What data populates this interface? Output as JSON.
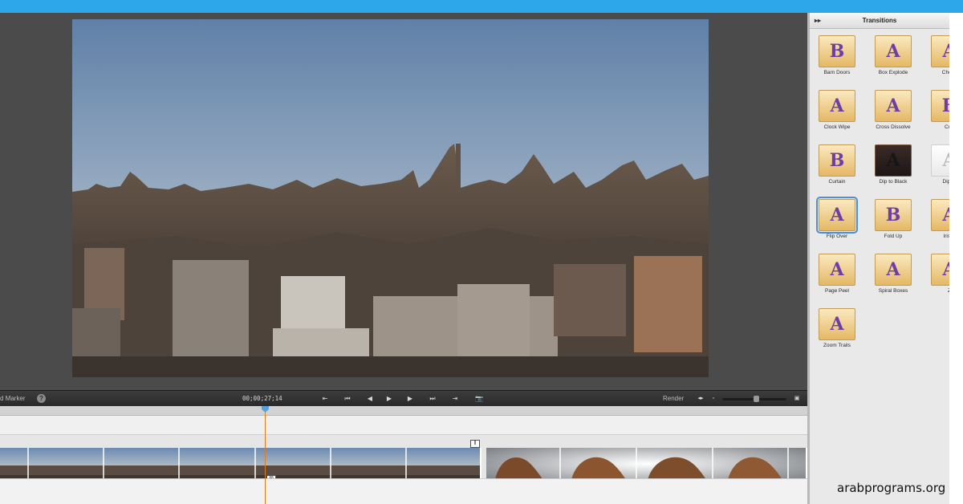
{
  "monitor": {
    "timecode": "00;00;27;14",
    "marker_label": "d Marker",
    "help_label": "?",
    "render_label": "Render",
    "controls": [
      {
        "name": "go-to-start-button",
        "glyph": "⇤"
      },
      {
        "name": "previous-edit-button",
        "glyph": "⏮"
      },
      {
        "name": "step-back-button",
        "glyph": "◀"
      },
      {
        "name": "play-button",
        "glyph": "▶"
      },
      {
        "name": "step-forward-button",
        "glyph": "▶"
      },
      {
        "name": "next-edit-button",
        "glyph": "⏭"
      },
      {
        "name": "go-to-end-button",
        "glyph": "⇥"
      },
      {
        "name": "snapshot-button",
        "glyph": "📷"
      }
    ]
  },
  "transitions": {
    "title": "Transitions",
    "collapse_glyph": "▸▸",
    "items": [
      {
        "label": "Barn Doors",
        "glyph": "B",
        "style": ""
      },
      {
        "label": "Box Explode",
        "glyph": "A",
        "style": ""
      },
      {
        "label": "Check",
        "glyph": "A",
        "style": ""
      },
      {
        "label": "Clock Wipe",
        "glyph": "A",
        "style": ""
      },
      {
        "label": "Cross Dissolve",
        "glyph": "A",
        "style": ""
      },
      {
        "label": "Cub",
        "glyph": "B",
        "style": ""
      },
      {
        "label": "Curtain",
        "glyph": "B",
        "style": ""
      },
      {
        "label": "Dip to Black",
        "glyph": "A",
        "style": "dark"
      },
      {
        "label": "Dip to",
        "glyph": "A",
        "style": "light"
      },
      {
        "label": "Flip Over",
        "glyph": "A",
        "style": "sel"
      },
      {
        "label": "Fold Up",
        "glyph": "B",
        "style": ""
      },
      {
        "label": "Iris D",
        "glyph": "A",
        "style": ""
      },
      {
        "label": "Page Peel",
        "glyph": "A",
        "style": ""
      },
      {
        "label": "Spiral Boxes",
        "glyph": "A",
        "style": ""
      },
      {
        "label": "Z",
        "glyph": "A",
        "style": ""
      },
      {
        "label": "Zoom Trails",
        "glyph": "A",
        "style": ""
      }
    ]
  },
  "timeline": {
    "transition_marker_glyph": "⊠",
    "end_marker_glyph": "‖"
  },
  "watermark": "arabprograms.org",
  "colors": {
    "accent": "#2ea7ea",
    "playhead": "#e07b1a",
    "transition_letter": "#6e3fa3"
  }
}
